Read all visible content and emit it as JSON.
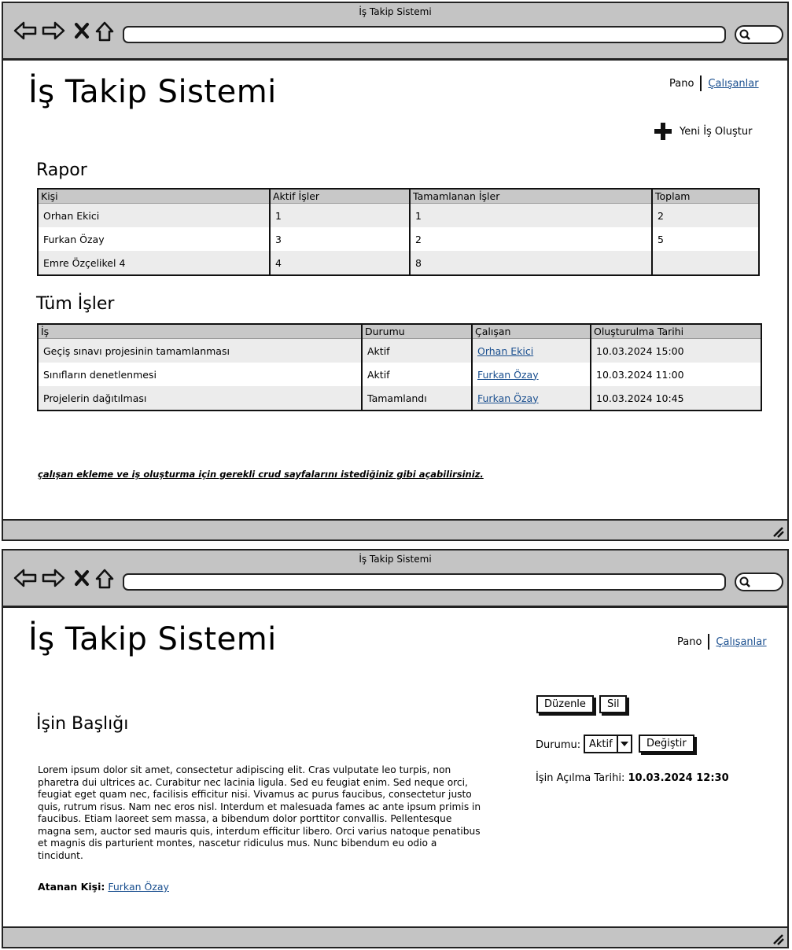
{
  "window1": {
    "window_title": "İş Takip Sistemi",
    "app_title": "İş Takip Sistemi",
    "nav": {
      "pano": "Pano",
      "calisanlar": "Çalışanlar"
    },
    "new_job_label": "Yeni İş Oluştur",
    "report": {
      "heading": "Rapor",
      "columns": [
        "Kişi",
        "Aktif İşler",
        "Tamamlanan İşler",
        "Toplam"
      ],
      "rows": [
        [
          "Orhan Ekici",
          "1",
          "1",
          "2"
        ],
        [
          "Furkan Özay",
          "3",
          "2",
          "5"
        ],
        [
          "Emre Özçelikel 4",
          "4",
          "8",
          ""
        ]
      ]
    },
    "jobs": {
      "heading": "Tüm İşler",
      "columns": [
        "İş",
        "Durumu",
        "Çalışan",
        "Oluşturulma Tarihi"
      ],
      "rows": [
        [
          "Geçiş sınavı projesinin tamamlanması",
          "Aktif",
          "Orhan Ekici",
          "10.03.2024 15:00"
        ],
        [
          "Sınıfların denetlenmesi",
          "Aktif",
          "Furkan Özay",
          "10.03.2024 11:00"
        ],
        [
          "Projelerin dağıtılması",
          "Tamamlandı",
          "Furkan Özay",
          "10.03.2024 10:45"
        ]
      ]
    },
    "note": "çalışan ekleme ve iş oluşturma için gerekli crud sayfalarını istediğiniz gibi açabilirsiniz."
  },
  "window2": {
    "window_title": "İş Takip Sistemi",
    "app_title": "İş Takip Sistemi",
    "nav": {
      "pano": "Pano",
      "calisanlar": "Çalışanlar"
    },
    "job_title": "İşin Başlığı",
    "body": "Lorem ipsum dolor sit amet, consectetur adipiscing elit. Cras vulputate leo turpis, non pharetra dui ultrices ac. Curabitur nec lacinia ligula. Sed eu feugiat enim. Sed neque orci, feugiat eget quam nec, facilisis efficitur nisi. Vivamus ac purus faucibus, consectetur justo quis, rutrum risus. Nam nec eros nisl. Interdum et malesuada fames ac ante ipsum primis in faucibus. Etiam laoreet sem massa, a bibendum dolor porttitor convallis. Pellentesque magna sem, auctor sed mauris quis, interdum efficitur libero. Orci varius natoque penatibus et magnis dis parturient montes, nascetur ridiculus mus. Nunc bibendum eu odio a tincidunt.",
    "assignee_label": "Atanan Kişi:",
    "assignee_name": "Furkan Özay",
    "edit_button": "Düzenle",
    "delete_button": "Sil",
    "status_label": "Durumu:",
    "status_value": "Aktif",
    "change_button": "Değiştir",
    "opened_label": "İşin Açılma Tarihi:",
    "opened_value": "10.03.2024 12:30"
  }
}
